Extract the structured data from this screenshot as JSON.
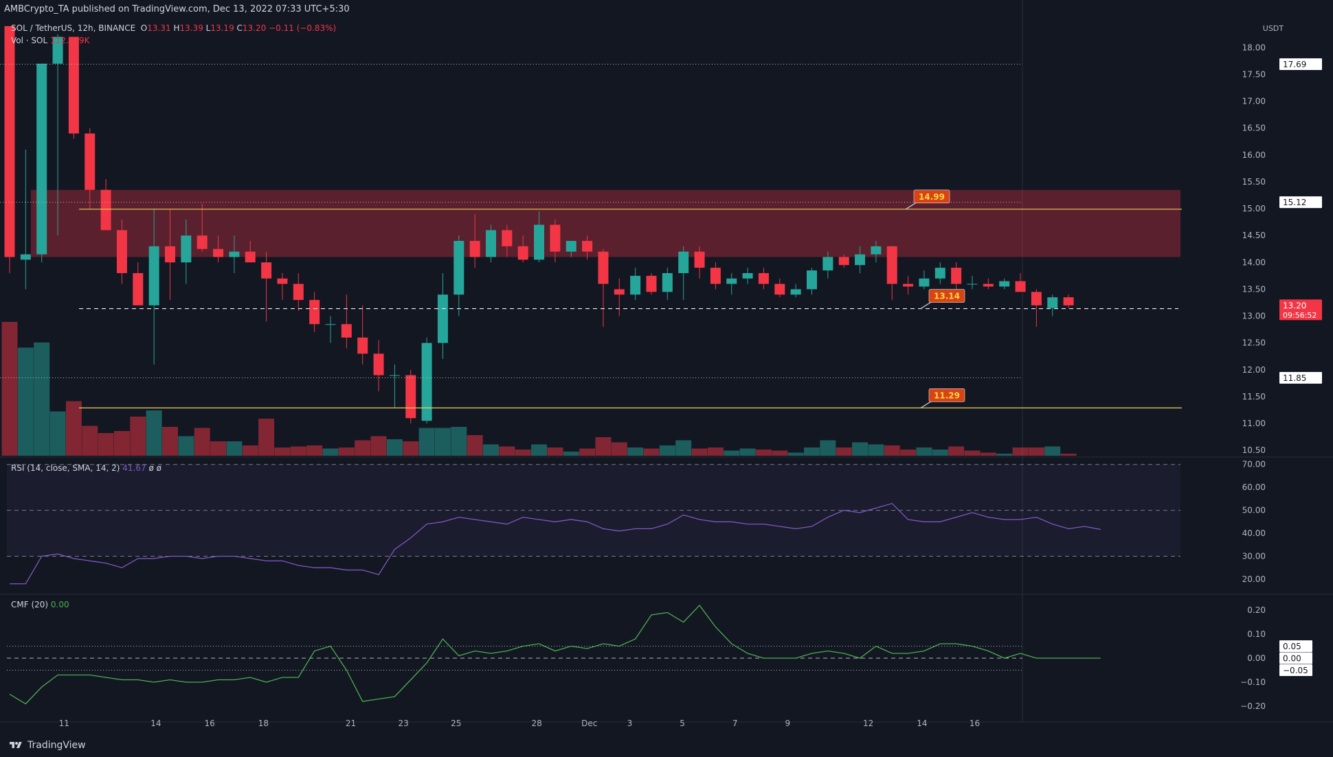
{
  "publisher": "AMBCrypto_TA published on TradingView.com, Dec 13, 2022 07:33 UTC+5:30",
  "footer_brand": "TradingView",
  "legend": {
    "symbol": "SOL / TetherUS, 12h, BINANCE",
    "o_label": "O",
    "o": "13.31",
    "h_label": "H",
    "h": "13.39",
    "l_label": "L",
    "l": "13.19",
    "c_label": "C",
    "c": "13.20",
    "change": "−0.11 (−0.83%)",
    "vol_label": "Vol · SOL",
    "vol": "112.889K",
    "rsi_label": "RSI (14, close, SMA, 14, 2)",
    "rsi_val": "41.67",
    "rsi_na": "ø ø",
    "cmf_label": "CMF (20)",
    "cmf_val": "0.00"
  },
  "colors": {
    "up": "#26a69a",
    "down": "#f23645",
    "background": "#131722",
    "rsi_line": "#7e57c2",
    "cmf_line": "#4caf50",
    "resistance_zone": "#f23645",
    "yellow_line": "#f0d15a",
    "label_bg": "#d84315",
    "label_text": "#f9d648"
  },
  "chart_data": [
    {
      "type": "candlestick",
      "title": "SOL / TetherUS, 12h, BINANCE",
      "currency": "USDT",
      "ylim": [
        10.4,
        18.4
      ],
      "yticks": [
        "10.50",
        "11.00",
        "11.50",
        "12.00",
        "12.50",
        "13.00",
        "13.50",
        "14.00",
        "14.50",
        "15.00",
        "15.50",
        "16.00",
        "16.50",
        "17.00",
        "17.50",
        "18.00"
      ],
      "xticks": [
        "11",
        "14",
        "16",
        "18",
        "21",
        "23",
        "25",
        "28",
        "Dec",
        "3",
        "5",
        "7",
        "9",
        "12",
        "14",
        "16"
      ],
      "price_labels": [
        {
          "value": "17.69",
          "style": "white"
        },
        {
          "value": "15.12",
          "style": "white"
        },
        {
          "value": "13.20",
          "style": "red",
          "sub": "09:56:52"
        },
        {
          "value": "11.85",
          "style": "white"
        }
      ],
      "dotted_levels": [
        17.69,
        15.12,
        11.85
      ],
      "horizontal_lines": [
        {
          "value": 14.99,
          "label": "14.99",
          "color": "yellow"
        },
        {
          "value": 13.14,
          "label": "13.14",
          "color": "white-dashed"
        },
        {
          "value": 11.29,
          "label": "11.29",
          "color": "yellow"
        }
      ],
      "resistance_zone": [
        14.1,
        15.35
      ],
      "candles": [
        {
          "o": 18.4,
          "h": 18.4,
          "l": 13.8,
          "c": 14.1
        },
        {
          "o": 14.05,
          "h": 16.1,
          "l": 13.5,
          "c": 14.15
        },
        {
          "o": 14.15,
          "h": 17.7,
          "l": 14.0,
          "c": 17.7
        },
        {
          "o": 17.7,
          "h": 18.25,
          "l": 14.5,
          "c": 18.2
        },
        {
          "o": 18.2,
          "h": 18.2,
          "l": 16.3,
          "c": 16.4
        },
        {
          "o": 16.4,
          "h": 16.5,
          "l": 15.0,
          "c": 15.35
        },
        {
          "o": 15.35,
          "h": 15.55,
          "l": 14.7,
          "c": 14.6
        },
        {
          "o": 14.6,
          "h": 14.8,
          "l": 13.6,
          "c": 13.8
        },
        {
          "o": 13.8,
          "h": 14.0,
          "l": 13.2,
          "c": 13.2
        },
        {
          "o": 13.2,
          "h": 15.0,
          "l": 12.1,
          "c": 14.3
        },
        {
          "o": 14.3,
          "h": 15.0,
          "l": 13.3,
          "c": 14.0
        },
        {
          "o": 14.0,
          "h": 14.8,
          "l": 13.6,
          "c": 14.5
        },
        {
          "o": 14.5,
          "h": 15.1,
          "l": 14.2,
          "c": 14.25
        },
        {
          "o": 14.25,
          "h": 14.5,
          "l": 14.0,
          "c": 14.1
        },
        {
          "o": 14.1,
          "h": 14.5,
          "l": 13.8,
          "c": 14.2
        },
        {
          "o": 14.2,
          "h": 14.4,
          "l": 14.0,
          "c": 14.0
        },
        {
          "o": 14.0,
          "h": 14.2,
          "l": 12.9,
          "c": 13.7
        },
        {
          "o": 13.7,
          "h": 13.8,
          "l": 13.3,
          "c": 13.6
        },
        {
          "o": 13.6,
          "h": 13.8,
          "l": 13.1,
          "c": 13.3
        },
        {
          "o": 13.3,
          "h": 13.45,
          "l": 12.7,
          "c": 12.85
        },
        {
          "o": 12.85,
          "h": 13.0,
          "l": 12.5,
          "c": 12.85
        },
        {
          "o": 12.85,
          "h": 13.4,
          "l": 12.4,
          "c": 12.6
        },
        {
          "o": 12.6,
          "h": 13.2,
          "l": 12.1,
          "c": 12.3
        },
        {
          "o": 12.3,
          "h": 12.55,
          "l": 11.6,
          "c": 11.9
        },
        {
          "o": 11.9,
          "h": 12.1,
          "l": 11.3,
          "c": 11.9
        },
        {
          "o": 11.9,
          "h": 12.0,
          "l": 11.0,
          "c": 11.1
        },
        {
          "o": 11.05,
          "h": 12.6,
          "l": 11.0,
          "c": 12.5
        },
        {
          "o": 12.5,
          "h": 13.8,
          "l": 12.2,
          "c": 13.4
        },
        {
          "o": 13.4,
          "h": 14.5,
          "l": 13.0,
          "c": 14.4
        },
        {
          "o": 14.4,
          "h": 14.9,
          "l": 13.9,
          "c": 14.1
        },
        {
          "o": 14.1,
          "h": 14.7,
          "l": 14.0,
          "c": 14.6
        },
        {
          "o": 14.6,
          "h": 14.7,
          "l": 14.1,
          "c": 14.3
        },
        {
          "o": 14.3,
          "h": 14.5,
          "l": 14.0,
          "c": 14.05
        },
        {
          "o": 14.05,
          "h": 14.95,
          "l": 14.0,
          "c": 14.7
        },
        {
          "o": 14.7,
          "h": 14.8,
          "l": 14.0,
          "c": 14.2
        },
        {
          "o": 14.2,
          "h": 14.4,
          "l": 14.1,
          "c": 14.4
        },
        {
          "o": 14.4,
          "h": 14.5,
          "l": 14.05,
          "c": 14.2
        },
        {
          "o": 14.2,
          "h": 14.25,
          "l": 12.8,
          "c": 13.6
        },
        {
          "o": 13.5,
          "h": 13.7,
          "l": 13.0,
          "c": 13.4
        },
        {
          "o": 13.4,
          "h": 13.9,
          "l": 13.3,
          "c": 13.75
        },
        {
          "o": 13.75,
          "h": 13.8,
          "l": 13.4,
          "c": 13.45
        },
        {
          "o": 13.45,
          "h": 13.9,
          "l": 13.3,
          "c": 13.8
        },
        {
          "o": 13.8,
          "h": 14.3,
          "l": 13.3,
          "c": 14.2
        },
        {
          "o": 14.2,
          "h": 14.3,
          "l": 13.7,
          "c": 13.9
        },
        {
          "o": 13.9,
          "h": 14.0,
          "l": 13.5,
          "c": 13.6
        },
        {
          "o": 13.6,
          "h": 13.8,
          "l": 13.4,
          "c": 13.7
        },
        {
          "o": 13.7,
          "h": 13.9,
          "l": 13.6,
          "c": 13.8
        },
        {
          "o": 13.8,
          "h": 13.9,
          "l": 13.5,
          "c": 13.6
        },
        {
          "o": 13.6,
          "h": 13.7,
          "l": 13.35,
          "c": 13.4
        },
        {
          "o": 13.4,
          "h": 13.6,
          "l": 13.35,
          "c": 13.5
        },
        {
          "o": 13.5,
          "h": 13.9,
          "l": 13.4,
          "c": 13.85
        },
        {
          "o": 13.85,
          "h": 14.2,
          "l": 13.7,
          "c": 14.1
        },
        {
          "o": 14.1,
          "h": 14.15,
          "l": 13.9,
          "c": 13.95
        },
        {
          "o": 13.95,
          "h": 14.3,
          "l": 13.8,
          "c": 14.15
        },
        {
          "o": 14.15,
          "h": 14.4,
          "l": 14.0,
          "c": 14.3
        },
        {
          "o": 14.3,
          "h": 14.3,
          "l": 13.3,
          "c": 13.6
        },
        {
          "o": 13.6,
          "h": 13.75,
          "l": 13.4,
          "c": 13.55
        },
        {
          "o": 13.55,
          "h": 13.85,
          "l": 13.5,
          "c": 13.7
        },
        {
          "o": 13.7,
          "h": 14.0,
          "l": 13.6,
          "c": 13.9
        },
        {
          "o": 13.9,
          "h": 14.0,
          "l": 13.5,
          "c": 13.6
        },
        {
          "o": 13.6,
          "h": 13.75,
          "l": 13.5,
          "c": 13.6
        },
        {
          "o": 13.6,
          "h": 13.7,
          "l": 13.5,
          "c": 13.55
        },
        {
          "o": 13.55,
          "h": 13.7,
          "l": 13.5,
          "c": 13.65
        },
        {
          "o": 13.65,
          "h": 13.8,
          "l": 13.5,
          "c": 13.45
        },
        {
          "o": 13.45,
          "h": 13.5,
          "l": 12.8,
          "c": 13.2
        },
        {
          "o": 13.15,
          "h": 13.4,
          "l": 13.0,
          "c": 13.35
        },
        {
          "o": 13.35,
          "h": 13.4,
          "l": 13.15,
          "c": 13.2
        }
      ],
      "volume": [
        {
          "v": 1.3,
          "up": false
        },
        {
          "v": 1.05,
          "up": true
        },
        {
          "v": 1.1,
          "up": true
        },
        {
          "v": 0.43,
          "up": true
        },
        {
          "v": 0.53,
          "up": false
        },
        {
          "v": 0.29,
          "up": false
        },
        {
          "v": 0.22,
          "up": false
        },
        {
          "v": 0.24,
          "up": false
        },
        {
          "v": 0.38,
          "up": false
        },
        {
          "v": 0.44,
          "up": true
        },
        {
          "v": 0.28,
          "up": false
        },
        {
          "v": 0.19,
          "up": true
        },
        {
          "v": 0.27,
          "up": false
        },
        {
          "v": 0.14,
          "up": false
        },
        {
          "v": 0.14,
          "up": true
        },
        {
          "v": 0.1,
          "up": false
        },
        {
          "v": 0.36,
          "up": false
        },
        {
          "v": 0.08,
          "up": false
        },
        {
          "v": 0.09,
          "up": false
        },
        {
          "v": 0.1,
          "up": false
        },
        {
          "v": 0.07,
          "up": true
        },
        {
          "v": 0.08,
          "up": false
        },
        {
          "v": 0.15,
          "up": false
        },
        {
          "v": 0.19,
          "up": false
        },
        {
          "v": 0.16,
          "up": true
        },
        {
          "v": 0.14,
          "up": false
        },
        {
          "v": 0.27,
          "up": true
        },
        {
          "v": 0.27,
          "up": true
        },
        {
          "v": 0.28,
          "up": true
        },
        {
          "v": 0.2,
          "up": false
        },
        {
          "v": 0.11,
          "up": true
        },
        {
          "v": 0.09,
          "up": false
        },
        {
          "v": 0.06,
          "up": false
        },
        {
          "v": 0.11,
          "up": true
        },
        {
          "v": 0.08,
          "up": false
        },
        {
          "v": 0.04,
          "up": true
        },
        {
          "v": 0.07,
          "up": false
        },
        {
          "v": 0.18,
          "up": false
        },
        {
          "v": 0.13,
          "up": false
        },
        {
          "v": 0.08,
          "up": true
        },
        {
          "v": 0.07,
          "up": false
        },
        {
          "v": 0.1,
          "up": true
        },
        {
          "v": 0.15,
          "up": true
        },
        {
          "v": 0.07,
          "up": false
        },
        {
          "v": 0.08,
          "up": false
        },
        {
          "v": 0.05,
          "up": true
        },
        {
          "v": 0.07,
          "up": true
        },
        {
          "v": 0.06,
          "up": false
        },
        {
          "v": 0.05,
          "up": false
        },
        {
          "v": 0.03,
          "up": true
        },
        {
          "v": 0.08,
          "up": true
        },
        {
          "v": 0.15,
          "up": true
        },
        {
          "v": 0.08,
          "up": false
        },
        {
          "v": 0.13,
          "up": true
        },
        {
          "v": 0.11,
          "up": true
        },
        {
          "v": 0.1,
          "up": false
        },
        {
          "v": 0.06,
          "up": false
        },
        {
          "v": 0.08,
          "up": true
        },
        {
          "v": 0.06,
          "up": true
        },
        {
          "v": 0.09,
          "up": false
        },
        {
          "v": 0.05,
          "up": false
        },
        {
          "v": 0.03,
          "up": false
        },
        {
          "v": 0.02,
          "up": true
        },
        {
          "v": 0.08,
          "up": false
        },
        {
          "v": 0.08,
          "up": false
        },
        {
          "v": 0.09,
          "up": true
        },
        {
          "v": 0.02,
          "up": false
        }
      ]
    },
    {
      "type": "line",
      "title": "RSI (14, close, SMA, 14, 2)",
      "ylim": [
        14,
        72
      ],
      "yticks": [
        "20.00",
        "30.00",
        "40.00",
        "50.00",
        "60.00",
        "70.00"
      ],
      "bands": [
        30,
        50,
        70
      ],
      "values": [
        18,
        18,
        30,
        31,
        29,
        28,
        27,
        25,
        29,
        29,
        30,
        30,
        29,
        30,
        30,
        29,
        28,
        28,
        26,
        25,
        25,
        24,
        24,
        22,
        33,
        38,
        44,
        45,
        47,
        46,
        45,
        44,
        47,
        46,
        45,
        46,
        45,
        42,
        41,
        42,
        42,
        44,
        48,
        46,
        45,
        45,
        44,
        44,
        43,
        42,
        43,
        47,
        50,
        49,
        51,
        53,
        46,
        45,
        45,
        47,
        49,
        47,
        46,
        46,
        47,
        44,
        42,
        43,
        41.67
      ]
    },
    {
      "type": "line",
      "title": "CMF (20)",
      "ylim": [
        -0.26,
        0.26
      ],
      "yticks": [
        "−0.20",
        "−0.10",
        "0.00",
        "0.10",
        "0.20"
      ],
      "levels": [
        {
          "value": 0.05,
          "label": "0.05"
        },
        {
          "value": 0.0,
          "label": "0.00"
        },
        {
          "value": -0.05,
          "label": "−0.05"
        }
      ],
      "values": [
        -0.15,
        -0.19,
        -0.12,
        -0.07,
        -0.07,
        -0.07,
        -0.08,
        -0.09,
        -0.09,
        -0.1,
        -0.09,
        -0.1,
        -0.1,
        -0.09,
        -0.09,
        -0.08,
        -0.1,
        -0.08,
        -0.08,
        0.03,
        0.05,
        -0.05,
        -0.18,
        -0.17,
        -0.16,
        -0.09,
        -0.02,
        0.08,
        0.01,
        0.03,
        0.02,
        0.03,
        0.05,
        0.06,
        0.03,
        0.05,
        0.04,
        0.06,
        0.05,
        0.08,
        0.18,
        0.19,
        0.15,
        0.22,
        0.13,
        0.06,
        0.02,
        0.0,
        0.0,
        0.0,
        0.02,
        0.03,
        0.02,
        0.0,
        0.05,
        0.02,
        0.02,
        0.03,
        0.06,
        0.06,
        0.05,
        0.03,
        0.0,
        0.02,
        0.0,
        0.0,
        0.0,
        0.0,
        0.0
      ]
    }
  ]
}
